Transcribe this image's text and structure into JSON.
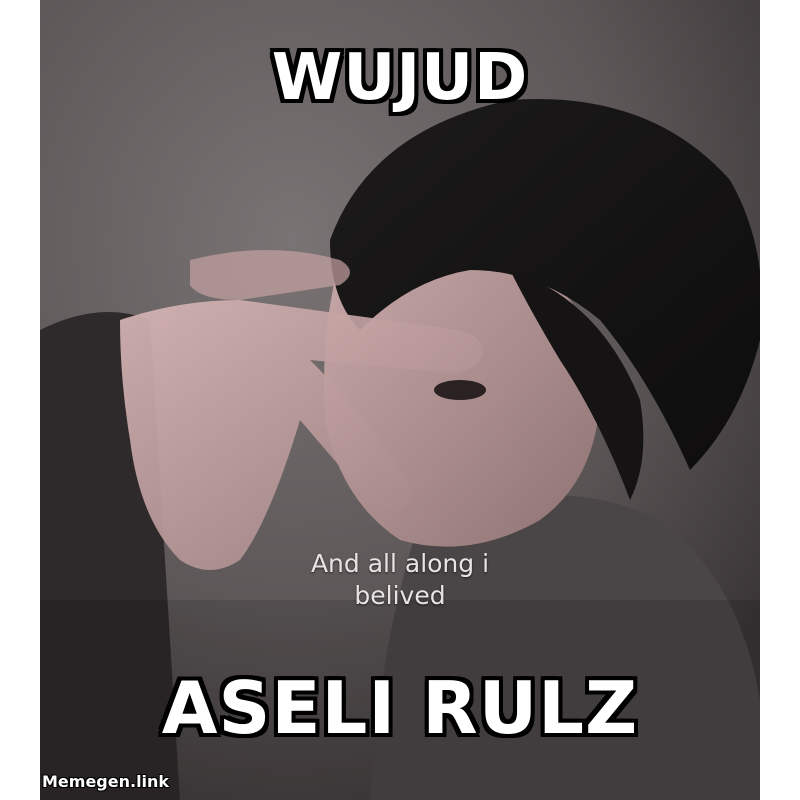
{
  "meme": {
    "top_text": "WUJUD",
    "bottom_text": "ASELI RULZ",
    "subtitle_line1": "And all along i",
    "subtitle_line2": "belived",
    "watermark": "Memegen.link"
  },
  "colors": {
    "caption_fill": "#ffffff",
    "caption_outline": "#000000",
    "photo_tone": "#5a5455"
  }
}
